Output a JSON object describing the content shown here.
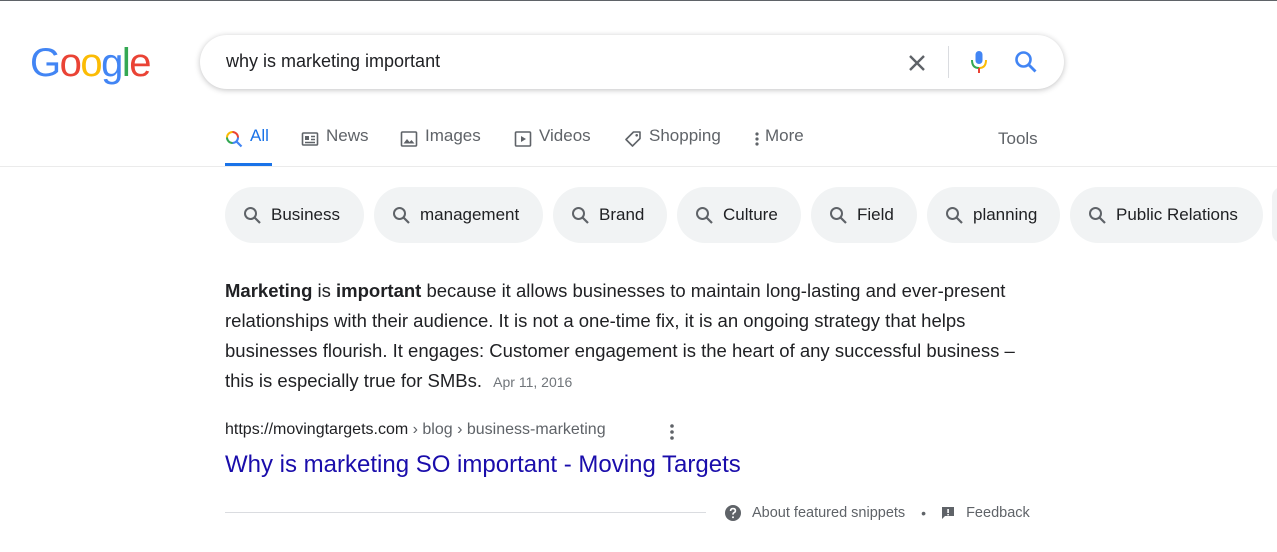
{
  "logo": {
    "letters": [
      "G",
      "o",
      "o",
      "g",
      "l",
      "e"
    ],
    "colors": [
      "#4285f4",
      "#ea4335",
      "#fbbc05",
      "#4285f4",
      "#34a853",
      "#ea4335"
    ]
  },
  "search": {
    "query": "why is marketing important"
  },
  "tabs": [
    {
      "label": "All",
      "icon": "search-icon",
      "active": true
    },
    {
      "label": "News",
      "icon": "news-icon"
    },
    {
      "label": "Images",
      "icon": "image-icon"
    },
    {
      "label": "Videos",
      "icon": "video-icon"
    },
    {
      "label": "Shopping",
      "icon": "tag-icon"
    },
    {
      "label": "More",
      "icon": "more-vert-icon"
    }
  ],
  "tools_label": "Tools",
  "chips": [
    "Business",
    "management",
    "Brand",
    "Culture",
    "Field",
    "planning",
    "Public Relations"
  ],
  "snippet": {
    "bold1": "Marketing",
    "text1": " is ",
    "bold2": "important",
    "text2": " because it allows businesses to maintain long-lasting and ever-present relationships with their audience. It is not a one-time fix, it is an ongoing strategy that helps businesses flourish. It engages: Customer engagement is the heart of any successful business – this is especially true for SMBs.",
    "date": "Apr 11, 2016"
  },
  "result": {
    "url": "https://movingtargets.com",
    "breadcrumb": " › blog › business-marketing",
    "title": "Why is marketing SO important - Moving Targets"
  },
  "footer": {
    "about": "About featured snippets",
    "separator": "•",
    "feedback": "Feedback"
  },
  "colors": {
    "accent": "#1a73e8",
    "link": "#1a0dab",
    "chip_bg": "#f1f3f4"
  }
}
